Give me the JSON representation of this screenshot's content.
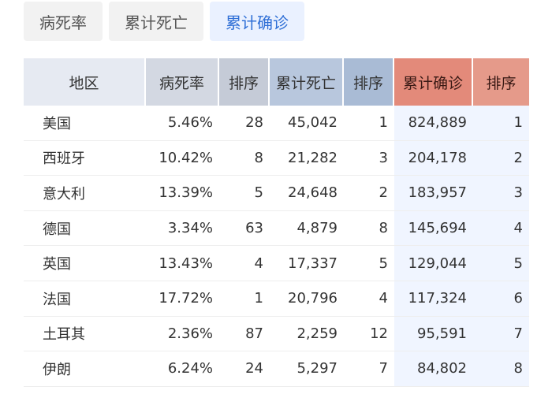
{
  "tabs": [
    {
      "label": "病死率",
      "active": false
    },
    {
      "label": "累计死亡",
      "active": false
    },
    {
      "label": "累计确诊",
      "active": true
    }
  ],
  "table": {
    "headers": [
      "地区",
      "病死率",
      "排序",
      "累计死亡",
      "排序",
      "累计确诊",
      "排序"
    ],
    "rows": [
      [
        "美国",
        "5.46%",
        "28",
        "45,042",
        "1",
        "824,889",
        "1"
      ],
      [
        "西班牙",
        "10.42%",
        "8",
        "21,282",
        "3",
        "204,178",
        "2"
      ],
      [
        "意大利",
        "13.39%",
        "5",
        "24,648",
        "2",
        "183,957",
        "3"
      ],
      [
        "德国",
        "3.34%",
        "63",
        "4,879",
        "8",
        "145,694",
        "4"
      ],
      [
        "英国",
        "13.43%",
        "4",
        "17,337",
        "5",
        "129,044",
        "5"
      ],
      [
        "法国",
        "17.72%",
        "1",
        "20,796",
        "4",
        "117,324",
        "6"
      ],
      [
        "土耳其",
        "2.36%",
        "87",
        "2,259",
        "12",
        "95,591",
        "7"
      ],
      [
        "伊朗",
        "6.24%",
        "24",
        "5,297",
        "7",
        "84,802",
        "8"
      ]
    ]
  },
  "colors": {
    "active_tab_text": "#2f6fd6",
    "active_tab_bg": "#eaf1ff",
    "confirmed_header": "#e38a7a",
    "highlight_column": "#f0f5ff"
  }
}
